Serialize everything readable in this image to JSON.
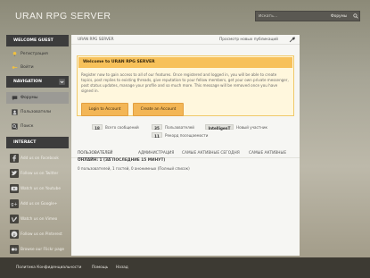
{
  "header": {
    "site_title": "URAN RPG SERVER",
    "search_placeholder": "Искать...",
    "search_scope": "Форумы"
  },
  "sidebar": {
    "guest_heading": "WELCOME GUEST",
    "guest_items": [
      {
        "label": "Регистрация",
        "icon": "lightbulb-icon"
      },
      {
        "label": "Войти",
        "icon": "key-icon"
      }
    ],
    "nav_heading": "NAVIGATION",
    "nav_items": [
      {
        "label": "Форумы",
        "icon": "comment-icon",
        "active": true
      },
      {
        "label": "Пользователи",
        "icon": "user-icon",
        "active": false
      },
      {
        "label": "Поиск",
        "icon": "search-icon",
        "active": false
      }
    ],
    "interact_heading": "INTERACT",
    "social_items": [
      {
        "label": "Add us on Facebook",
        "icon": "facebook-icon"
      },
      {
        "label": "Follow us on Twitter",
        "icon": "twitter-icon"
      },
      {
        "label": "Watch us on Youtube",
        "icon": "youtube-icon"
      },
      {
        "label": "Add us on Google+",
        "icon": "google-plus-icon"
      },
      {
        "label": "Watch us on Vimeo",
        "icon": "vimeo-icon"
      },
      {
        "label": "Follow us on Pinterest",
        "icon": "pinterest-icon"
      },
      {
        "label": "Browse our Flickr page",
        "icon": "flickr-icon"
      }
    ]
  },
  "main": {
    "breadcrumb": "URAN RPG SERVER",
    "new_posts": "Просмотр новых публикаций",
    "notice": {
      "title": "Welcome to URAN RPG SERVER",
      "text": "Register now to gain access to all of our features. Once registered and logged in, you will be able to create topics, post replies to existing threads, give reputation to your fellow members, get your own private messenger, post status updates, manage your profile and so much more. This message will be removed once you have signed in.",
      "login_label": "Login to Account",
      "create_label": "Create an Account"
    },
    "stats": {
      "total_posts_num": "18",
      "total_posts_label": "Всего сообщений",
      "users_num": "35",
      "users_label": "Пользователей",
      "newest_member": "IntelligenT",
      "newest_label": "Новый участник",
      "record_num": "11",
      "record_label": "Рекорд посещаемости"
    },
    "tabs": [
      "ПОЛЬЗОВАТЕЛЕЙ",
      "АДМИНИСТРАЦИЯ",
      "САМЫЕ АКТИВНЫЕ СЕГОДНЯ",
      "САМЫЕ АКТИВНЫЕ"
    ],
    "online_heading": "ОНЛАЙН: 1 (ЗА ПОСЛЕДНИЕ 15 МИНУТ)",
    "online_text": "0 пользователей, 1 гостей, 0 анонимных   (Полный список)"
  },
  "footer": {
    "links": [
      "Политика Конфиденциальности",
      "Помощь",
      "Назад"
    ]
  },
  "colors": {
    "notice_header": "#f7c15a",
    "button": "#f3b656",
    "sidebar_heading": "#3c3c3c",
    "footer": "#3d3a33"
  }
}
